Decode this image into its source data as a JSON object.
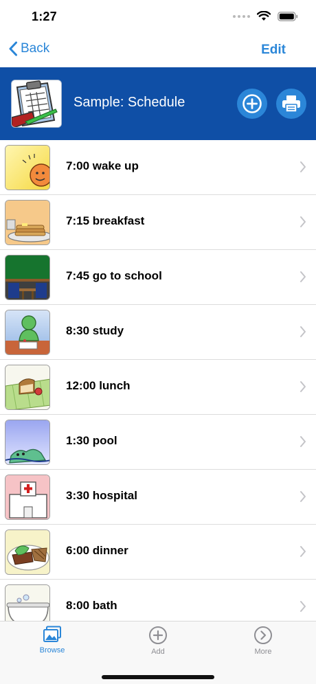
{
  "status": {
    "time": "1:27"
  },
  "nav": {
    "back_label": "Back",
    "edit_label": "Edit"
  },
  "header": {
    "title": "Sample: Schedule"
  },
  "items": [
    {
      "label": "7:00 wake up",
      "icon": "sun-wake-icon"
    },
    {
      "label": "7:15 breakfast",
      "icon": "pancakes-icon"
    },
    {
      "label": "7:45 go to school",
      "icon": "classroom-icon"
    },
    {
      "label": "8:30 study",
      "icon": "study-icon"
    },
    {
      "label": "12:00 lunch",
      "icon": "lunch-icon"
    },
    {
      "label": "1:30 pool",
      "icon": "pool-icon"
    },
    {
      "label": "3:30 hospital",
      "icon": "hospital-icon"
    },
    {
      "label": "6:00 dinner",
      "icon": "dinner-icon"
    },
    {
      "label": "8:00 bath",
      "icon": "bathtub-icon"
    }
  ],
  "tabs": [
    {
      "label": "Browse",
      "active": true
    },
    {
      "label": "Add",
      "active": false
    },
    {
      "label": "More",
      "active": false
    }
  ],
  "colors": {
    "accent": "#2a86d8",
    "header_band": "#0f4fa6",
    "inactive_tab": "#8e8e93"
  }
}
